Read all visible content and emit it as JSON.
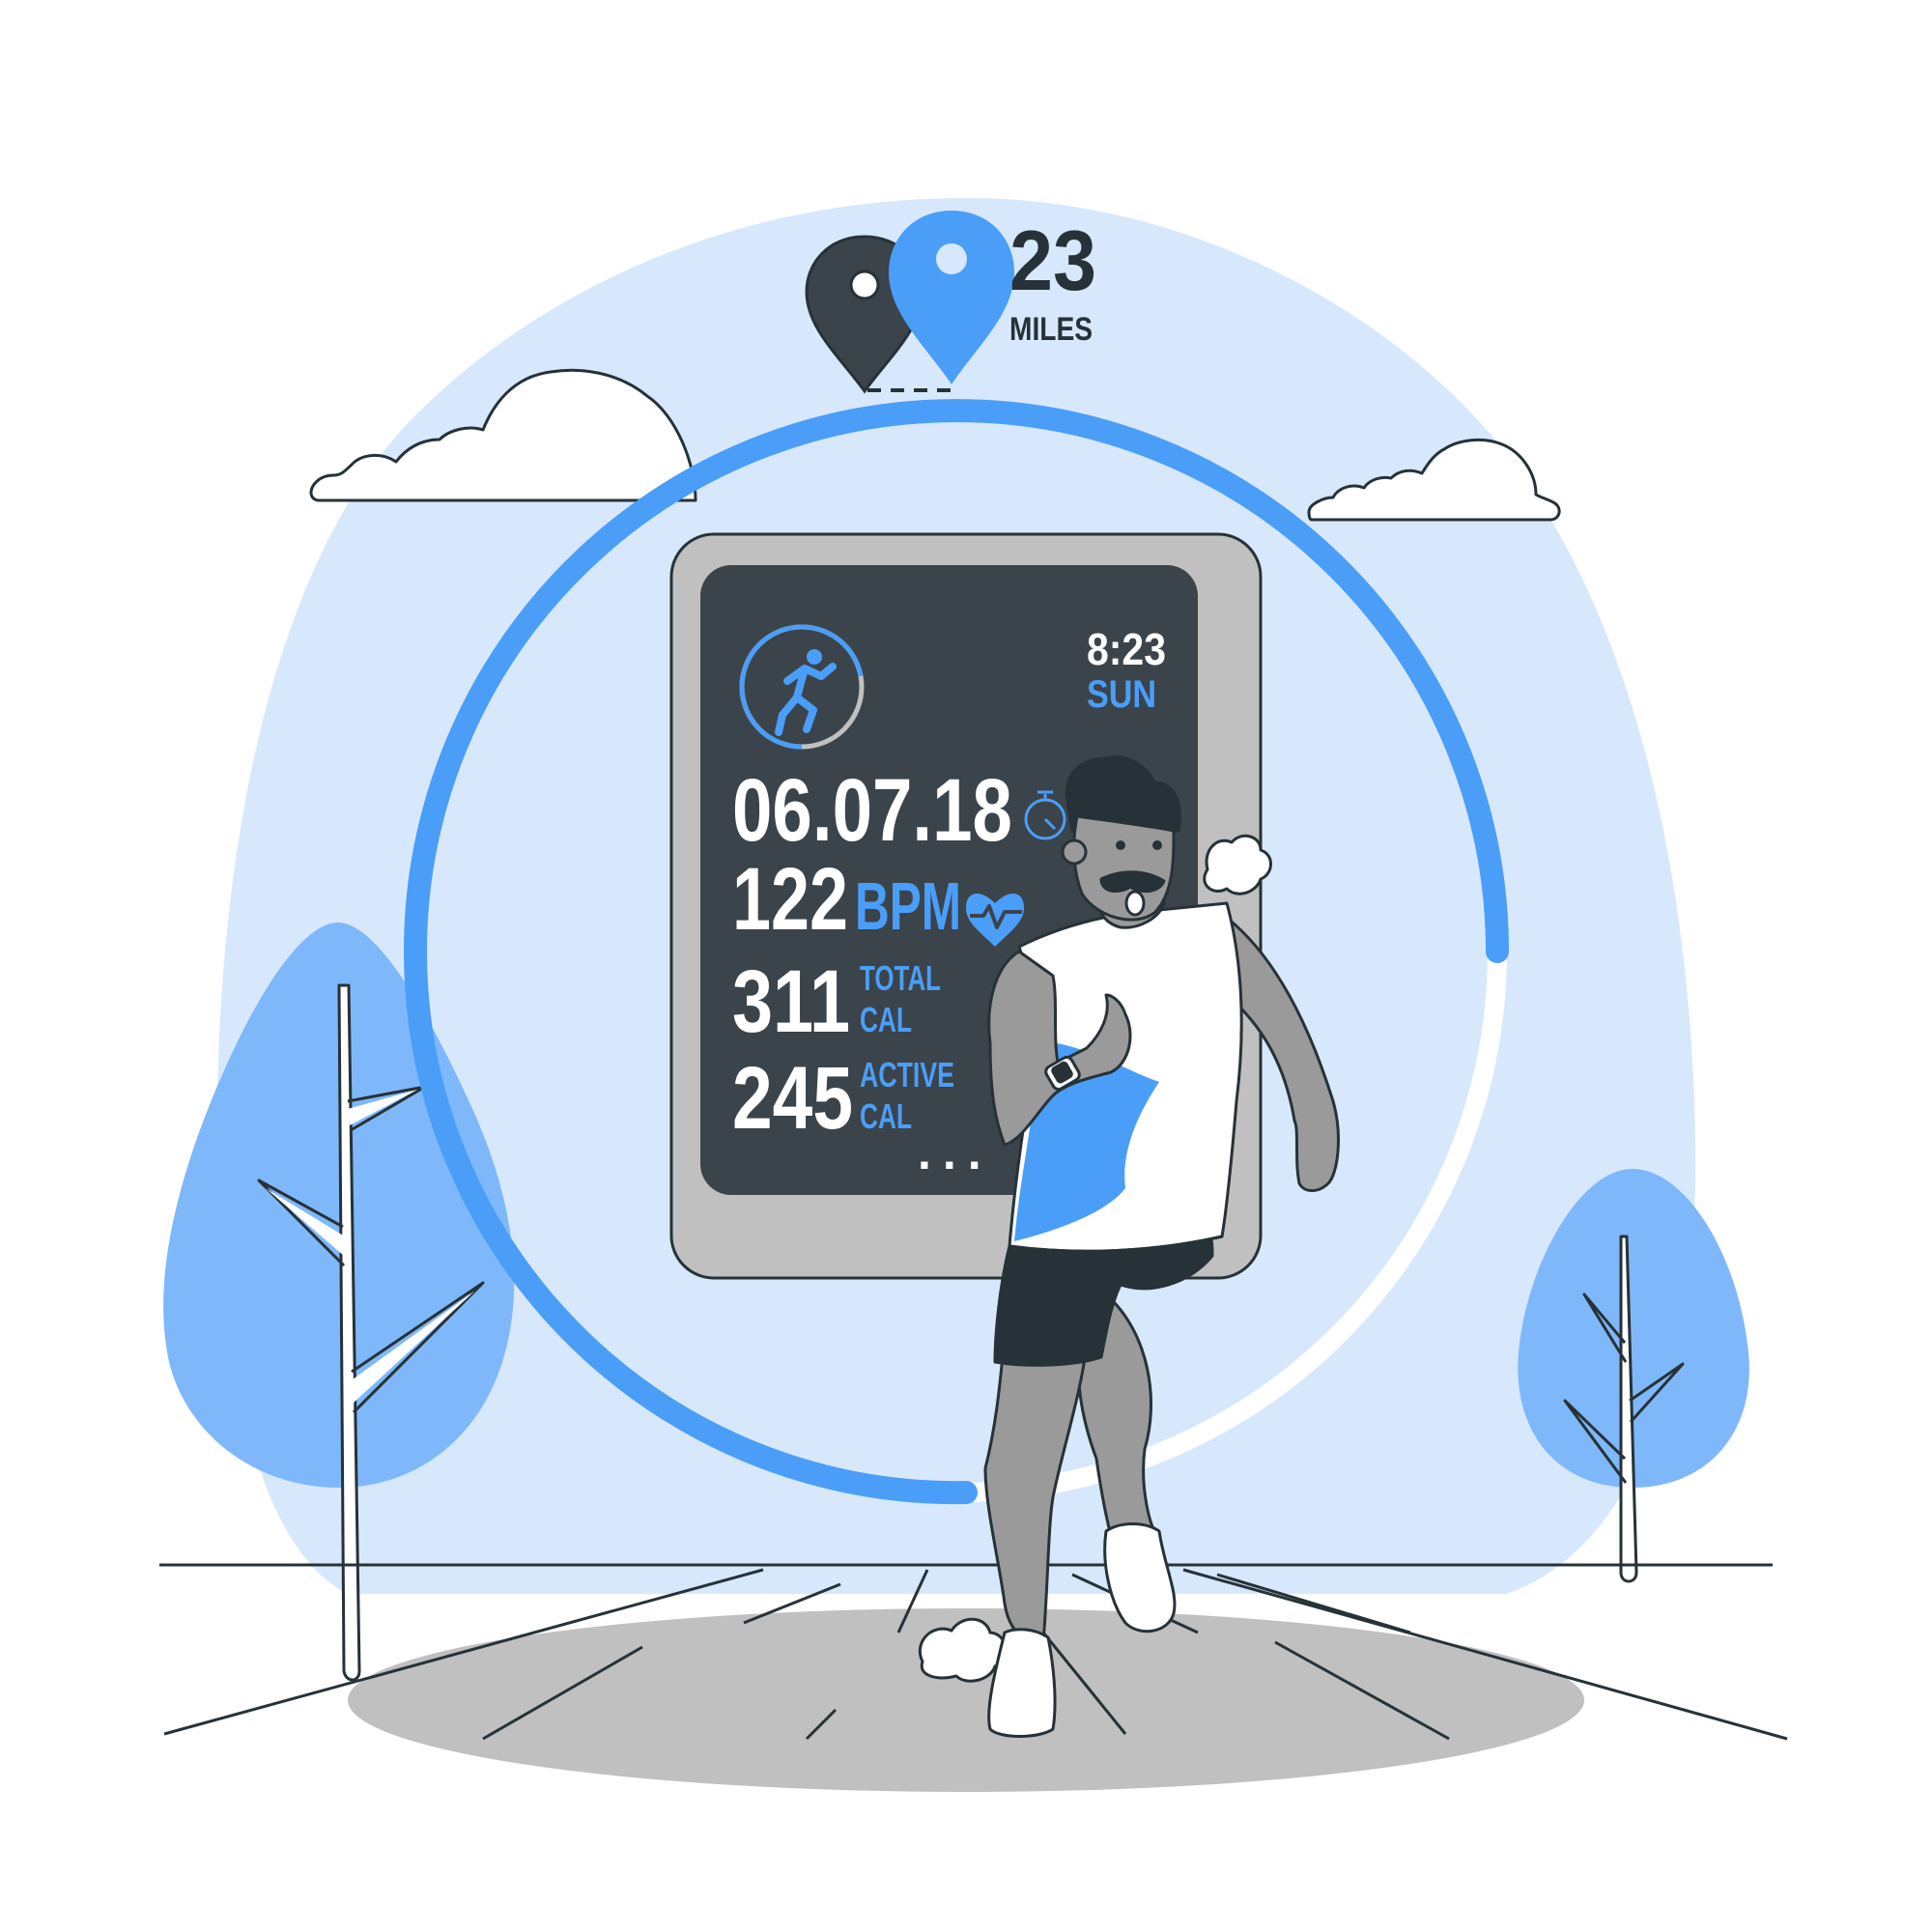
{
  "distance": {
    "value": "23",
    "unit": "MILES"
  },
  "watch": {
    "time": "8:23",
    "day": "SUN",
    "date": "06.07.18",
    "heart_rate": {
      "value": "122",
      "unit": "BPM"
    },
    "total_calories": {
      "value": "311",
      "label_line1": "TOTAL",
      "label_line2": "CAL"
    },
    "active_calories": {
      "value": "245",
      "label_line1": "ACTIVE",
      "label_line2": "CAL"
    },
    "more_indicator": "...",
    "activity_ring_progress": 0.78
  },
  "icons": {
    "start_pin": "map-pin-icon",
    "end_pin": "map-pin-icon",
    "activity": "runner-icon",
    "stopwatch": "stopwatch-icon",
    "heart": "heart-pulse-icon"
  },
  "colors": {
    "accent_blue": "#4a9ef8",
    "light_blue_bg": "#d7e8fd",
    "tree_blue": "#7fb8fa",
    "screen_dark": "#3b444b",
    "device_gray": "#c0c0c0",
    "ink": "#263238",
    "skin_gray": "#9a9a9a"
  }
}
